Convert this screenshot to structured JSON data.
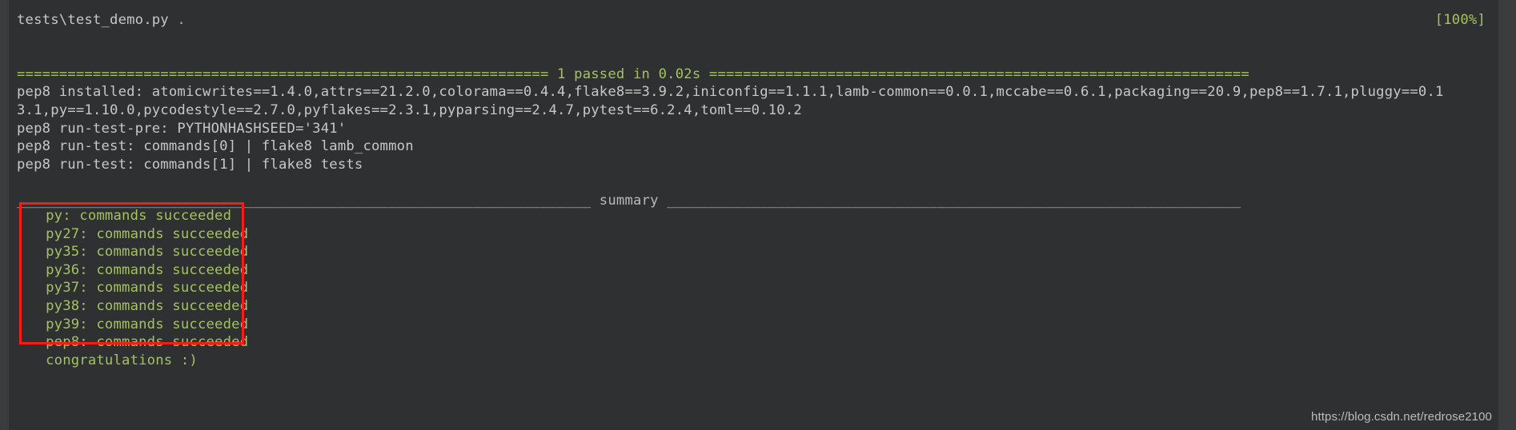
{
  "terminal": {
    "background_color": "#2f3032",
    "gutter_color": "#3b3c3e",
    "default_text_color": "#c6c8c6",
    "success_color": "#a5c261",
    "annotation_color": "#fd1c15",
    "pytest_header": {
      "test_file_line": "tests\\test_demo.py ",
      "test_result_dot": ".",
      "progress": "[100%]"
    },
    "summary_separator": "=============================================================== 1 passed in 0.02s ================================================================",
    "tox_lines": [
      "pep8 installed: atomicwrites==1.4.0,attrs==21.2.0,colorama==0.4.4,flake8==3.9.2,iniconfig==1.1.1,lamb-common==0.0.1,mccabe==0.6.1,packaging==20.9,pep8==1.7.1,pluggy==0.1",
      "3.1,py==1.10.0,pycodestyle==2.7.0,pyflakes==2.3.1,pyparsing==2.4.7,pytest==6.2.4,toml==0.10.2",
      "pep8 run-test-pre: PYTHONHASHSEED='341'",
      "pep8 run-test: commands[0] | flake8 lamb_common",
      "pep8 run-test: commands[1] | flake8 tests"
    ],
    "summary_header": "____________________________________________________________________ summary ____________________________________________________________________",
    "summary_results": [
      "  py: commands succeeded",
      "  py27: commands succeeded",
      "  py35: commands succeeded",
      "  py36: commands succeeded",
      "  py37: commands succeeded",
      "  py38: commands succeeded",
      "  py39: commands succeeded",
      "  pep8: commands succeeded",
      "  congratulations :)"
    ]
  },
  "watermark": {
    "text": "https://blog.csdn.net/redrose2100"
  }
}
